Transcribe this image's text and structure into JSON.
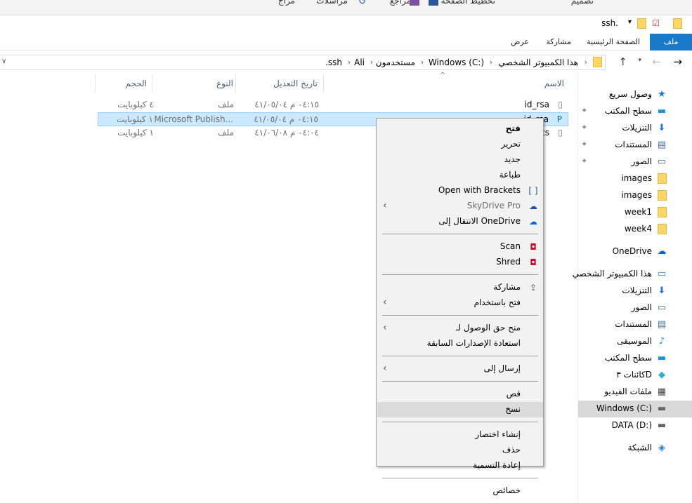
{
  "word_ribbon": {
    "tabs": [
      "تصميم",
      "تخطيط الصفحة",
      "مراجع",
      "مراسلات",
      "مراج"
    ]
  },
  "title": {
    "folder": "ssh."
  },
  "ribbon": {
    "tabs": [
      {
        "label": "ملف",
        "active": true
      },
      {
        "label": "الصفحة الرئيسية"
      },
      {
        "label": "مشاركة"
      },
      {
        "label": "عرض"
      }
    ]
  },
  "address": {
    "crumbs": [
      "هذا الكمبيوتر الشخصي",
      "Windows (C:)",
      "مستخدمون",
      "Ali",
      ".ssh"
    ]
  },
  "columns": {
    "name": "الاسم",
    "date": "تاريخ التعديل",
    "type": "النوع",
    "size": "الحجم"
  },
  "files": [
    {
      "name": "id_rsa",
      "date": "٠٤:١٥ م ٤١/٠٥/٠٤",
      "type": "ملف",
      "size": "٤ كيلوبايت",
      "selected": false
    },
    {
      "name": "id_rsa",
      "date": "٠٤:١٥ م ٤١/٠٥/٠٤",
      "type": "Microsoft Publish...",
      "size": "١ كيلوبايت",
      "selected": true,
      "icon": "publisher-icon"
    },
    {
      "name": "known_hosts",
      "date": "٠٤:٠٤ م ٤١/٠٦/٠٨",
      "type": "ملف",
      "size": "١ كيلوبايت",
      "selected": false
    }
  ],
  "context_menu": [
    {
      "label": "فتح",
      "bold": true
    },
    {
      "label": "تحرير"
    },
    {
      "label": "جديد"
    },
    {
      "label": "طباعة"
    },
    {
      "label": "Open with Brackets",
      "icon": "brackets-icon"
    },
    {
      "label": "SkyDrive Pro",
      "icon": "skydrive-icon",
      "disabled": true,
      "submenu": true
    },
    {
      "label": "الانتقال إلى OneDrive",
      "icon": "onedrive-icon"
    },
    {
      "sep": true
    },
    {
      "label": "Scan",
      "icon": "mcafee-icon"
    },
    {
      "label": "Shred",
      "icon": "mcafee-icon"
    },
    {
      "sep": true
    },
    {
      "label": "مشاركة",
      "icon": "share-icon"
    },
    {
      "label": "فتح باستخدام",
      "submenu": true
    },
    {
      "sep": true
    },
    {
      "label": "منح حق الوصول لـ",
      "submenu": true
    },
    {
      "label": "استعادة الإصدارات السابقة"
    },
    {
      "sep": true
    },
    {
      "label": "إرسال إلى",
      "submenu": true
    },
    {
      "sep": true
    },
    {
      "label": "قص"
    },
    {
      "label": "نسخ",
      "highlighted": true
    },
    {
      "sep": true
    },
    {
      "label": "إنشاء اختصار"
    },
    {
      "label": "حذف"
    },
    {
      "label": "إعادة التسمية"
    },
    {
      "sep": true
    },
    {
      "label": "خصائص"
    }
  ],
  "nav": [
    {
      "label": "وصول سريع",
      "icon": "star-icon"
    },
    {
      "label": "سطح المكتب",
      "icon": "desktop-icon",
      "pinned": true
    },
    {
      "label": "التنزيلات",
      "icon": "download-icon",
      "pinned": true
    },
    {
      "label": "المستندات",
      "icon": "documents-icon",
      "pinned": true
    },
    {
      "label": "الصور",
      "icon": "pictures-icon",
      "pinned": true
    },
    {
      "label": "images",
      "icon": "folder-icon"
    },
    {
      "label": "images",
      "icon": "folder-icon"
    },
    {
      "label": "week1",
      "icon": "folder-icon"
    },
    {
      "label": "week4",
      "icon": "folder-icon"
    },
    {
      "label": "OneDrive",
      "icon": "onedrive-icon",
      "gap": true
    },
    {
      "label": "هذا الكمبيوتر الشخصي",
      "icon": "pc-icon",
      "gap": true
    },
    {
      "label": "التنزيلات",
      "icon": "download-icon"
    },
    {
      "label": "الصور",
      "icon": "pictures-icon"
    },
    {
      "label": "المستندات",
      "icon": "documents-icon"
    },
    {
      "label": "الموسيقى",
      "icon": "music-icon"
    },
    {
      "label": "سطح المكتب",
      "icon": "desktop-icon"
    },
    {
      "label": "كائنات ٣D",
      "icon": "3d-objects-icon"
    },
    {
      "label": "ملفات الفيديو",
      "icon": "video-icon"
    },
    {
      "label": "Windows (C:)",
      "icon": "drive-icon",
      "selected": true
    },
    {
      "label": "DATA (D:)",
      "icon": "drive-icon"
    },
    {
      "label": "الشبكة",
      "icon": "network-icon",
      "gap": true
    }
  ],
  "colors": {
    "accent": "#1979ca",
    "selection": "#cce8ff",
    "menu_bg": "#f2f2f2"
  }
}
